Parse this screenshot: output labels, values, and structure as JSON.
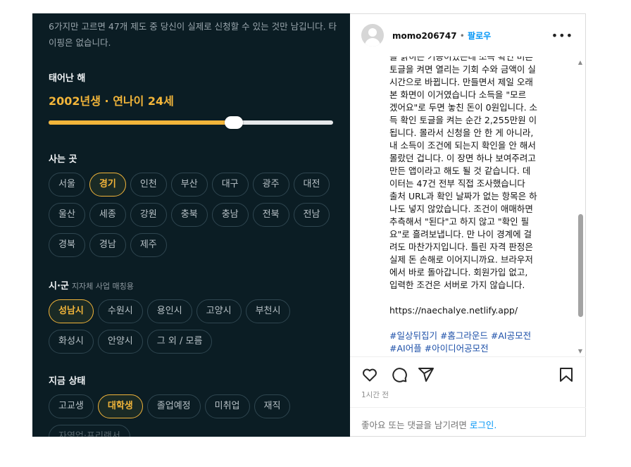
{
  "form": {
    "intro": "6가지만 고르면 47개 제도 중 당신이 실제로 신청할 수 있는 것만 남깁니다. 타이핑은 없습니다.",
    "birth": {
      "title": "태어난 해",
      "value": "2002년생 · 연나이 24세",
      "slider_fraction": 0.65
    },
    "region": {
      "title": "사는 곳",
      "options": [
        "서울",
        "경기",
        "인천",
        "부산",
        "대구",
        "광주",
        "대전",
        "울산",
        "세종",
        "강원",
        "충북",
        "충남",
        "전북",
        "전남",
        "경북",
        "경남",
        "제주"
      ],
      "selected": "경기"
    },
    "city": {
      "title": "시·군",
      "subtitle": "지자체 사업 매칭용",
      "options": [
        "성남시",
        "수원시",
        "용인시",
        "고양시",
        "부천시",
        "화성시",
        "안양시",
        "그 외 / 모름"
      ],
      "selected": "성남시"
    },
    "status": {
      "title": "지금 상태",
      "options": [
        "고교생",
        "대학생",
        "졸업예정",
        "미취업",
        "재직",
        "자영업·프리랜서"
      ],
      "selected": "대학생"
    }
  },
  "post": {
    "username": "momo206747",
    "separator": "•",
    "follow_label": "팔로우",
    "more_label": "•••",
    "caption_lines": [
      "을 밝히는 기능이었는데 소득 확인 버튼",
      "토글을 켜면 열리는 기회 수와 금액이 실",
      "시간으로 바뀝니다.  만들면서 제일 오래",
      "본 화면이 이거였습니다  소득을 \"모르",
      "겠어요\"로 두면 놓친 돈이 0원입니다. 소",
      "득 확인 토글을 켜는 순간 2,255만원 이",
      "됩니다.  몰라서 신청을 안 한 게 아니라,",
      "내 소득이 조건에 되는지 확인을 안 해서",
      "몰랐던 겁니다. 이 장면 하나 보여주려고",
      "만든 앱이라고 해도 될 것 같습니다.  데",
      "이터는 47건 전부 직접 조사했습니다",
      "출처 URL과 확인 날짜가 없는 항목은 하",
      "나도 넣지 않았습니다. 조건이 애매하면",
      "추측해서 \"된다\"고 하지 않고 \"확인 필",
      "요\"로 흘려보냅니다. 만 나이 경계에 걸",
      "려도 마찬가지입니다. 틀린 자격 판정은",
      "실제 돈 손해로 이어지니까요.  브라우저",
      "에서 바로 돌아갑니다. 회원가입 없고,",
      "입력한 조건은 서버로 가지 않습니다."
    ],
    "link": "https://naechalye.netlify.app/",
    "hashtags_line1": "#일상뒤집기 #홈그라운드 #AI공모전",
    "hashtags_line2": "#AI어플 #아이디어공모전",
    "timestamp": "1시간 전",
    "login_prompt": "좋아요 또는 댓글을 남기려면",
    "login_link": "로그인."
  },
  "colors": {
    "panel_bg": "#0b1d24",
    "accent": "#f2b53a",
    "link_blue": "#0095f6",
    "hashtag": "#1c4fa8"
  }
}
